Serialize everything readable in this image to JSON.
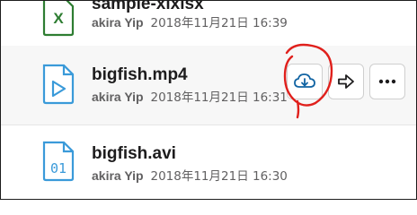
{
  "files": [
    {
      "name": "sample-xlxlsx",
      "author": "akira Yip",
      "date": "2018年11月21日 16:39",
      "icon": "spreadsheet-file-icon",
      "icon_color": "#2e7d32"
    },
    {
      "name": "bigfish.mp4",
      "author": "akira Yip",
      "date": "2018年11月21日 16:31",
      "icon": "video-file-icon",
      "icon_color": "#3a9ad9"
    },
    {
      "name": "bigfish.avi",
      "author": "akira Yip",
      "date": "2018年11月21日 16:30",
      "icon": "binary-file-icon",
      "icon_color": "#3a9ad9",
      "icon_text": "01"
    }
  ],
  "colors": {
    "annotation": "#e0201c",
    "accent": "#1264a3"
  },
  "actions": [
    "download-icon",
    "share-arrow-icon",
    "more-icon"
  ]
}
